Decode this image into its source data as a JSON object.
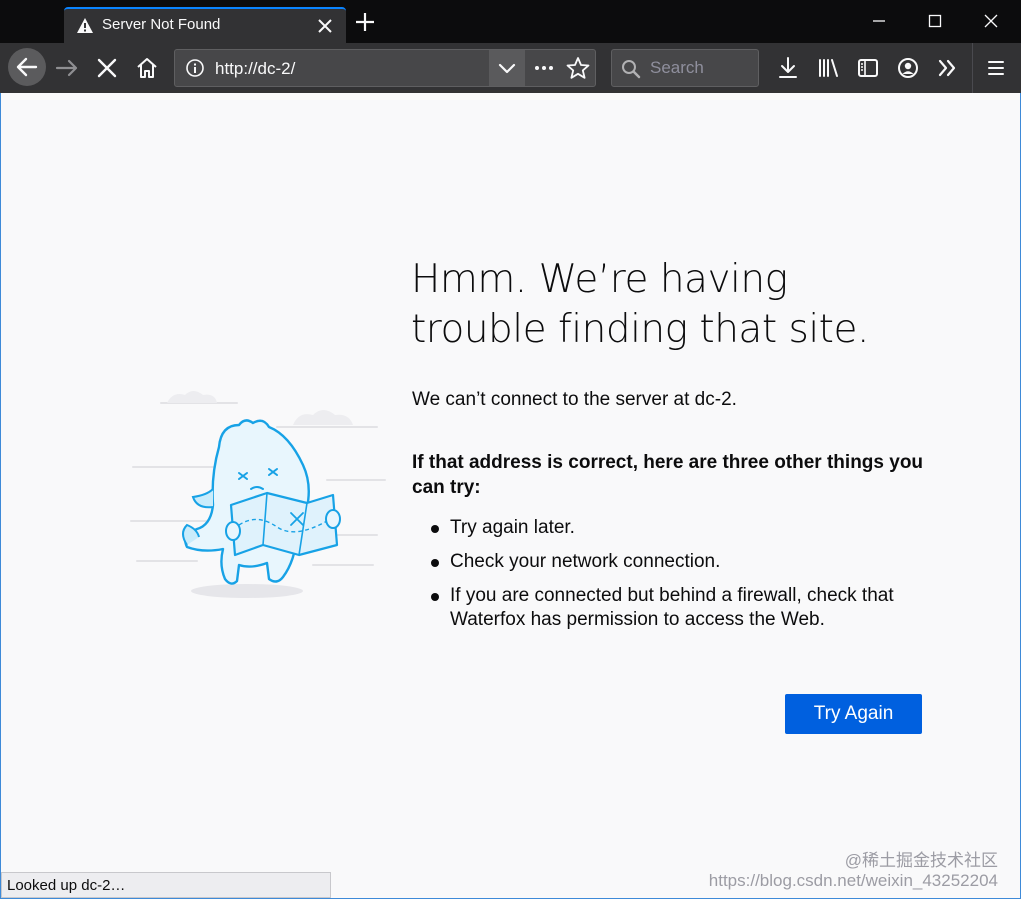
{
  "tab": {
    "title": "Server Not Found",
    "status_icon": "warning-icon"
  },
  "navbar": {
    "url": "http://dc-2/",
    "search_placeholder": "Search"
  },
  "error_page": {
    "heading_line1": "Hmm. We’re having",
    "heading_line2": "trouble finding that site.",
    "description": "We can’t connect to the server at dc-2.",
    "try_heading": "If that address is correct, here are three other things you can try:",
    "tips": [
      "Try again later.",
      "Check your network connection.",
      "If you are connected but behind a firewall, check that Waterfox has permission to access the Web."
    ],
    "try_again_label": "Try Again"
  },
  "status_bar": {
    "text": "Looked up dc-2…"
  },
  "watermark": {
    "line1": "@稀土掘金技术社区",
    "line2": "https://blog.csdn.net/weixin_43252204"
  },
  "colors": {
    "accent": "#0060df",
    "chrome_dark": "#0c0c0d",
    "toolbar": "#323234",
    "page_bg": "#f9f9fa",
    "illustration_blue": "#17a2e6"
  }
}
